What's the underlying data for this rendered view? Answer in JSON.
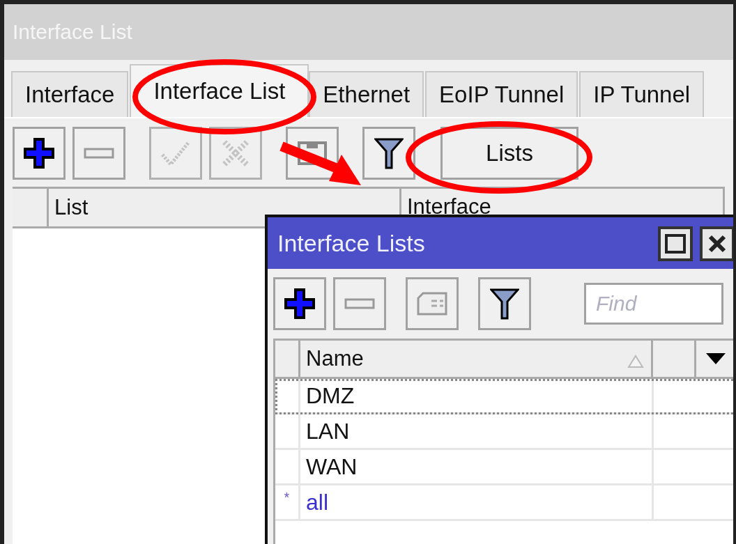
{
  "window": {
    "title": "Interface List"
  },
  "tabs": [
    {
      "label": "Interface",
      "selected": false
    },
    {
      "label": "Interface List",
      "selected": true
    },
    {
      "label": "Ethernet",
      "selected": false
    },
    {
      "label": "EoIP Tunnel",
      "selected": false
    },
    {
      "label": "IP Tunnel",
      "selected": false
    }
  ],
  "toolbar": [
    {
      "kind": "add",
      "disabled": false
    },
    {
      "kind": "remove",
      "disabled": false
    },
    {
      "kind": "enable",
      "disabled": true
    },
    {
      "kind": "disable",
      "disabled": true
    },
    {
      "kind": "comment",
      "disabled": false
    },
    {
      "kind": "filter",
      "disabled": false
    },
    {
      "kind": "text",
      "label": "Lists",
      "disabled": false
    }
  ],
  "table": {
    "columns": [
      "List",
      "Interface"
    ]
  },
  "dialog": {
    "title": "Interface Lists",
    "toolbar": [
      {
        "kind": "add",
        "disabled": false
      },
      {
        "kind": "remove",
        "disabled": false
      },
      {
        "kind": "note",
        "disabled": false
      },
      {
        "kind": "filter",
        "disabled": false
      }
    ],
    "search": {
      "placeholder": "Find"
    },
    "columns": [
      "Name"
    ],
    "rows": [
      {
        "name": "DMZ",
        "focused": true,
        "dynamic": false
      },
      {
        "name": "LAN",
        "focused": false,
        "dynamic": false
      },
      {
        "name": "WAN",
        "focused": false,
        "dynamic": false
      },
      {
        "flag": "*",
        "name": "all",
        "focused": false,
        "dynamic": true
      }
    ]
  }
}
